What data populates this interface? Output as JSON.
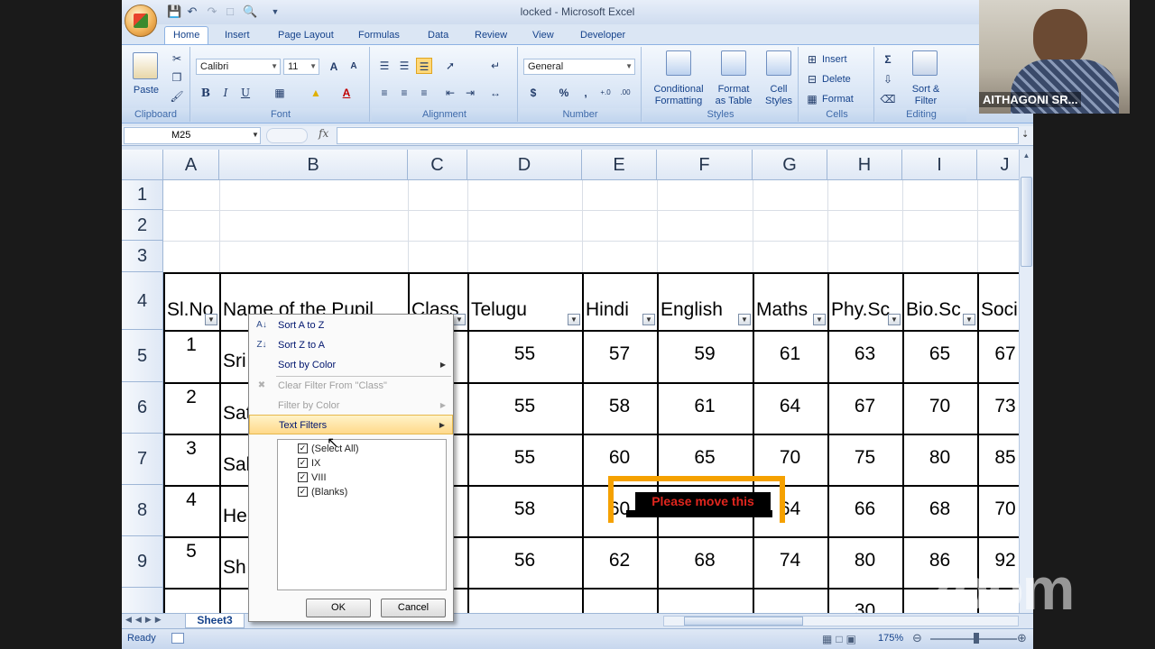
{
  "window": {
    "title": "locked - Microsoft Excel"
  },
  "tabs": [
    "Home",
    "Insert",
    "Page Layout",
    "Formulas",
    "Data",
    "Review",
    "View",
    "Developer"
  ],
  "ribbon": {
    "clipboard": {
      "label": "Clipboard",
      "paste": "Paste"
    },
    "font": {
      "label": "Font",
      "name": "Calibri",
      "size": "11",
      "bold": "B",
      "italic": "I",
      "underline": "U",
      "grow": "A",
      "shrink": "A",
      "color_btn": "A"
    },
    "alignment": {
      "label": "Alignment"
    },
    "number": {
      "label": "Number",
      "format": "General",
      "currency": "$",
      "percent": "%",
      "comma": ",",
      "inc": "+.0",
      "dec": ".00"
    },
    "styles": {
      "label": "Styles",
      "conditional": "Conditional Formatting",
      "conditional_l1": "Conditional",
      "conditional_l2": "Formatting",
      "format_table_l1": "Format",
      "format_table_l2": "as Table",
      "cell_styles_l1": "Cell",
      "cell_styles_l2": "Styles"
    },
    "cells": {
      "label": "Cells",
      "insert": "Insert",
      "delete": "Delete",
      "format": "Format"
    },
    "editing": {
      "label": "Editing",
      "sort_l1": "Sort &",
      "sort_l2": "Filter"
    }
  },
  "formula_bar": {
    "name_box": "M25",
    "fx": "fx",
    "value": ""
  },
  "columns": [
    "A",
    "B",
    "C",
    "D",
    "E",
    "F",
    "G",
    "H",
    "I",
    "J"
  ],
  "rows": [
    "1",
    "2",
    "3",
    "4",
    "5",
    "6",
    "7",
    "8",
    "9"
  ],
  "headers": {
    "A": "Sl.No",
    "B": "Name of the Pupil",
    "C": "Class",
    "D": "Telugu",
    "E": "Hindi",
    "F": "English",
    "G": "Maths",
    "H": "Phy.Sc",
    "I": "Bio.Sc",
    "J": "Soci"
  },
  "data_rows": [
    {
      "sl": "1",
      "name": "Sri",
      "telugu": "55",
      "hindi": "57",
      "english": "59",
      "maths": "61",
      "physc": "63",
      "biosc": "65",
      "soci": "67"
    },
    {
      "sl": "2",
      "name": "Sat",
      "telugu": "55",
      "hindi": "58",
      "english": "61",
      "maths": "64",
      "physc": "67",
      "biosc": "70",
      "soci": "73"
    },
    {
      "sl": "3",
      "name": "Sal",
      "telugu": "55",
      "hindi": "60",
      "english": "65",
      "maths": "70",
      "physc": "75",
      "biosc": "80",
      "soci": "85"
    },
    {
      "sl": "4",
      "name": "He",
      "telugu": "58",
      "hindi": "60",
      "english": "",
      "maths": "64",
      "physc": "66",
      "biosc": "68",
      "soci": "70"
    },
    {
      "sl": "5",
      "name": "Sh",
      "telugu": "56",
      "hindi": "62",
      "english": "68",
      "maths": "74",
      "physc": "80",
      "biosc": "86",
      "soci": "92"
    }
  ],
  "row10_partial": {
    "physc": "30"
  },
  "filter_menu": {
    "sort_az": "Sort A to Z",
    "sort_za": "Sort Z to A",
    "sort_color": "Sort by Color",
    "clear_filter": "Clear Filter From \"Class\"",
    "filter_color": "Filter by Color",
    "text_filters": "Text Filters",
    "items": [
      "(Select All)",
      "IX",
      "VIII",
      "(Blanks)"
    ],
    "ok": "OK",
    "cancel": "Cancel"
  },
  "sheet_tab": "Sheet3",
  "status": {
    "ready": "Ready",
    "zoom": "175%"
  },
  "annotation": {
    "text": "Please move this"
  },
  "webcam": {
    "name": "AITHAGONI SR..."
  },
  "watermark": "zoom",
  "colors": {
    "accent_orange": "#f5a100",
    "annotation_red": "#e0261e",
    "ribbon_blue": "#15428b"
  }
}
